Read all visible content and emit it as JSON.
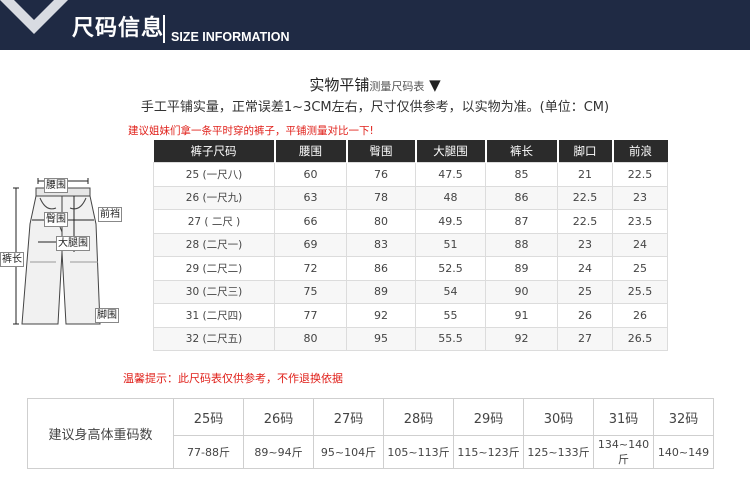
{
  "header": {
    "title_cn": "尺码信息",
    "title_en": "SIZE INFORMATION"
  },
  "section": {
    "title": "实物平铺",
    "title_sub": "测量尺码表",
    "title_arrow": "▼",
    "desc": "手工平铺实量，正常误差1~3CM左右，尺寸仅供参考，以实物为准。(单位：CM)",
    "note_top": "建议姐妹们拿一条平时穿的裤子，平铺测量对比一下!",
    "note_bottom": "温馨提示：此尺码表仅供参考，不作退换依据"
  },
  "size_table": {
    "headers": [
      "裤子尺码",
      "腰围",
      "臀围",
      "大腿围",
      "裤长",
      "脚口",
      "前浪"
    ],
    "rows": [
      [
        "25 (一尺八)",
        "60",
        "76",
        "47.5",
        "85",
        "21",
        "22.5"
      ],
      [
        "26 (一尺九)",
        "63",
        "78",
        "48",
        "86",
        "22.5",
        "23"
      ],
      [
        "27 (  二尺  )",
        "66",
        "80",
        "49.5",
        "87",
        "22.5",
        "23.5"
      ],
      [
        "28 (二尺一)",
        "69",
        "83",
        "51",
        "88",
        "23",
        "24"
      ],
      [
        "29 (二尺二)",
        "72",
        "86",
        "52.5",
        "89",
        "24",
        "25"
      ],
      [
        "30 (二尺三)",
        "75",
        "89",
        "54",
        "90",
        "25",
        "25.5"
      ],
      [
        "31 (二尺四)",
        "77",
        "92",
        "55",
        "91",
        "26",
        "26"
      ],
      [
        "32 (二尺五)",
        "80",
        "95",
        "55.5",
        "92",
        "27",
        "26.5"
      ]
    ]
  },
  "diagram": {
    "labels": {
      "waist": "腰围",
      "hip": "臀围",
      "rise": "前裆",
      "thigh": "大腿围",
      "length": "裤长",
      "hem": "脚围"
    }
  },
  "recommend": {
    "label": "建议身高体重码数",
    "sizes": [
      "25码",
      "26码",
      "27码",
      "28码",
      "29码",
      "30码",
      "31码",
      "32码"
    ],
    "weights": [
      "77-88斤",
      "89~94斤",
      "95~104斤",
      "105~113斤",
      "115~123斤",
      "125~133斤",
      "134~140斤",
      "140~149"
    ]
  }
}
